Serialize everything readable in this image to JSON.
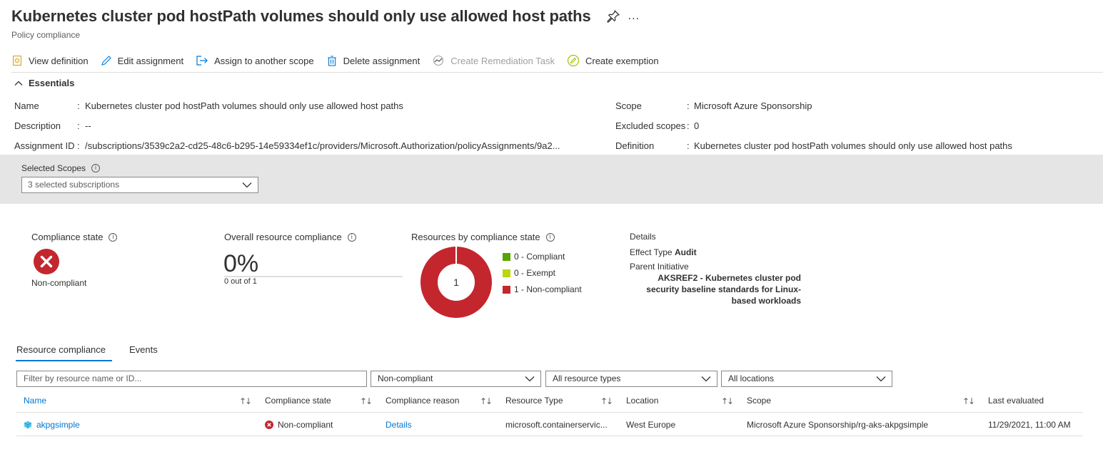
{
  "header": {
    "title": "Kubernetes cluster pod hostPath volumes should only use allowed host paths",
    "subtitle": "Policy compliance",
    "more": "..."
  },
  "toolbar": {
    "view_definition": "View definition",
    "edit_assignment": "Edit assignment",
    "assign_to_scope": "Assign to another scope",
    "delete_assignment": "Delete assignment",
    "create_remediation": "Create Remediation Task",
    "create_exemption": "Create exemption"
  },
  "essentials": {
    "toggle_label": "Essentials",
    "name_label": "Name",
    "name_value": "Kubernetes cluster pod hostPath volumes should only use allowed host paths",
    "description_label": "Description",
    "description_value": "--",
    "assignment_id_label": "Assignment ID",
    "assignment_id_value": "/subscriptions/3539c2a2-cd25-48c6-b295-14e59334ef1c/providers/Microsoft.Authorization/policyAssignments/9a2...",
    "scope_label": "Scope",
    "scope_value": "Microsoft Azure Sponsorship",
    "excluded_label": "Excluded scopes",
    "excluded_value": "0",
    "definition_label": "Definition",
    "definition_value": "Kubernetes cluster pod hostPath volumes should only use allowed host paths",
    "colon": ":"
  },
  "selected_scopes": {
    "label": "Selected Scopes",
    "value": "3 selected subscriptions"
  },
  "summary": {
    "compliance_state_label": "Compliance state",
    "compliance_state_value": "Non-compliant",
    "overall_label": "Overall resource compliance",
    "overall_percent": "0%",
    "overall_sub": "0 out of 1",
    "resources_label": "Resources by compliance state",
    "donut_total": "1",
    "legend": [
      {
        "label": "0 - Compliant",
        "count": 0,
        "color": "#57a300"
      },
      {
        "label": "0 - Exempt",
        "count": 0,
        "color": "#bad80a"
      },
      {
        "label": "1 - Non-compliant",
        "count": 1,
        "color": "#c4262e"
      }
    ],
    "details_title": "Details",
    "effect_label": "Effect Type",
    "effect_value": "Audit",
    "parent_label": "Parent Initiative",
    "parent_value": "AKSREF2 - Kubernetes cluster pod security baseline standards for Linux-based workloads"
  },
  "tabs": [
    {
      "label": "Resource compliance"
    },
    {
      "label": "Events"
    }
  ],
  "filters": {
    "search_placeholder": "Filter by resource name or ID...",
    "compliance": "Non-compliant",
    "resource_types": "All resource types",
    "locations": "All locations"
  },
  "table": {
    "columns": [
      "Name",
      "Compliance state",
      "Compliance reason",
      "Resource Type",
      "Location",
      "Scope",
      "Last evaluated"
    ],
    "rows": [
      {
        "name": "akpgsimple",
        "compliance_state": "Non-compliant",
        "compliance_reason": "Details",
        "resource_type": "microsoft.containerservic...",
        "location": "West Europe",
        "scope": "Microsoft Azure Sponsorship/rg-aks-akpgsimple",
        "last_evaluated": "11/29/2021, 11:00 AM"
      }
    ]
  },
  "colors": {
    "accent": "#0078d4",
    "non_compliant": "#c4262e",
    "panel_bg": "#e5e5e5"
  }
}
